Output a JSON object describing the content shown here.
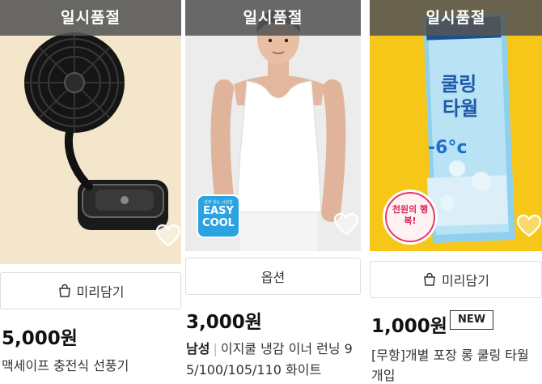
{
  "products": [
    {
      "status_overlay": "일시품절",
      "cart_button_label": "미리담기",
      "price": "5,000원",
      "name": "맥세이프 충전식 선풍기"
    },
    {
      "status_overlay": "일시품절",
      "badge_line1": "쉽게 읽는 시원함",
      "badge_line2": "EASY",
      "badge_line3": "COOL",
      "option_button_label": "옵션",
      "price": "3,000원",
      "brand": "남성",
      "name": "이지쿨 냉감 이너 런닝 9",
      "name_line2": "5/100/105/110 화이트"
    },
    {
      "status_overlay": "일시품절",
      "package_title_1": "쿨링",
      "package_title_2": "타월",
      "package_temp": "-6°c",
      "package_sticker": "천원의 행복!",
      "cart_button_label": "미리담기",
      "price": "1,000원",
      "new_badge": "NEW",
      "name": "[무항]개별 포장 롱 쿨링 타월",
      "name_line2": "개입"
    }
  ]
}
